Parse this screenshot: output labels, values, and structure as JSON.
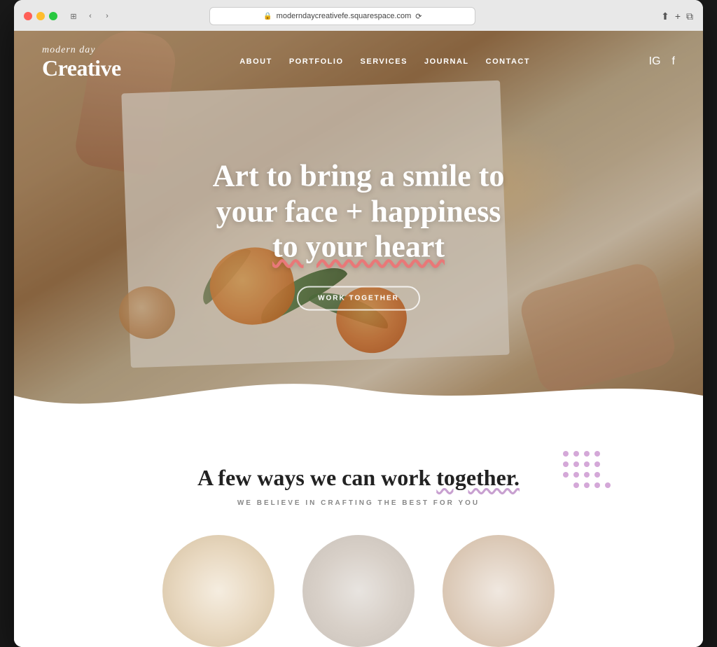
{
  "browser": {
    "url": "moderndaycreativefe.squarespace.com",
    "reload_label": "⟳"
  },
  "nav": {
    "logo_script": "modern day",
    "logo_main": "Creative",
    "links": [
      {
        "label": "ABOUT",
        "key": "about"
      },
      {
        "label": "PORTFOLIO",
        "key": "portfolio"
      },
      {
        "label": "SERVICES",
        "key": "services"
      },
      {
        "label": "JOURNAL",
        "key": "journal"
      },
      {
        "label": "CONTACT",
        "key": "contact"
      }
    ]
  },
  "hero": {
    "headline_line1": "Art to bring a smile to",
    "headline_line2": "your face + happiness",
    "headline_line3": "to your heart",
    "cta_label": "WORK TOGETHER"
  },
  "below_fold": {
    "heading": "A few ways we can work together.",
    "subheading": "WE BELIEVE IN CRAFTING THE BEST FOR YOU"
  },
  "icons": {
    "lock": "🔒",
    "instagram": "IG",
    "facebook": "f",
    "back": "‹",
    "forward": "›",
    "grid": "⊞",
    "share": "⬆",
    "plus": "+",
    "duplicate": "⧉"
  }
}
